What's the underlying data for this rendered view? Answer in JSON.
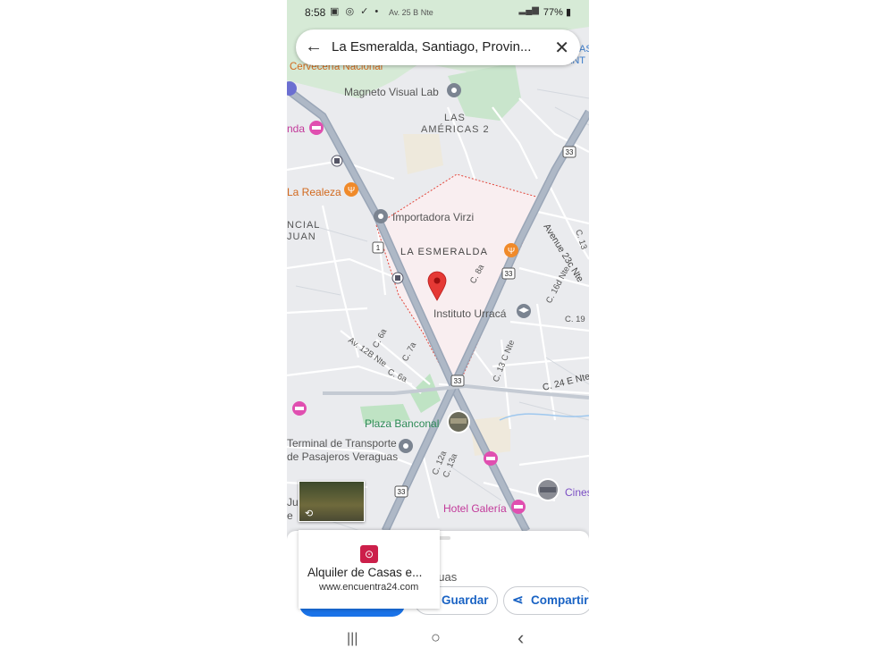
{
  "status_bar": {
    "time": "8:58",
    "left_icons": [
      "gallery-icon",
      "whatsapp-icon",
      "check-icon",
      "dot-icon"
    ],
    "street_label": "Av. 25 B Nte",
    "battery": "77%"
  },
  "search": {
    "query": "La Esmeralda, Santiago, Provin..."
  },
  "map_labels": {
    "cerveceria": "Cervecería Nacional",
    "magneto": "Magneto Visual Lab",
    "las": "LAS",
    "americas": "AMÉRICAS 2",
    "nda": "nda",
    "realeza": "La Realeza",
    "ncial": "NCIAL",
    "juan": "JUAN",
    "importadora": "Importadora Virzi",
    "esmeralda": "LA ESMERALDA",
    "instituto": "Instituto Urracá",
    "avenue": "Avenue 23c Nte",
    "c16d": "C. 16d Nte",
    "c13": "C. 13",
    "c19": "C. 19",
    "c8a": "C. 8a",
    "c13c": "C. 13 C Nte",
    "c24e": "C. 24 E Nte",
    "av12b": "Av. 12B Nte",
    "c6a": "C. 6a",
    "c7a": "C. 7a",
    "c6a2": "C. 6a",
    "plaza": "Plaza Banconal",
    "terminal1": "Terminal de Transporte",
    "terminal2": "de Pasajeros Veraguas",
    "c12a": "C. 12a",
    "c13a": "C. 13a",
    "hotel": "Hotel Galería",
    "cine": "Cines",
    "ju": "Ju",
    "e": "e",
    "as": "AS",
    "ant": "ANT",
    "r33a": "33",
    "r33b": "33",
    "r33c": "33",
    "r33d": "33",
    "r1": "1"
  },
  "bottom_sheet": {
    "subtitle": "guas",
    "save_label": "Guardar",
    "share_label": "Compartir"
  },
  "ad": {
    "title": "Alquiler de Casas e...",
    "url": "www.encuentra24.com"
  },
  "nav_bar": {
    "recents": "|||",
    "home": "○",
    "back": "‹"
  },
  "colors": {
    "map_bg": "#eaebee",
    "road": "#c4cad3",
    "highway": "#9aa6b7",
    "green": "#c4e6c9",
    "area_fill": "#f9eef0",
    "border": "#e3473c",
    "pin": "#e53935",
    "food": "#f08a2a",
    "hotel": "#e04fb0",
    "accent": "#1a73e8"
  }
}
